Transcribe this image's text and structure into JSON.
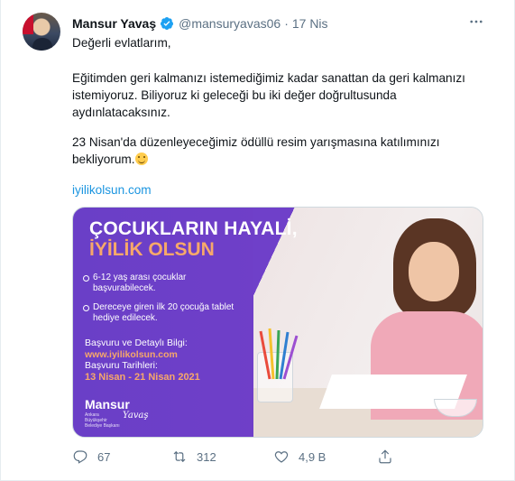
{
  "tweet": {
    "author_name": "Mansur Yavaş",
    "handle": "@mansuryavas06",
    "separator": "·",
    "date": "17 Nis",
    "verified": true,
    "more_icon": "ellipsis-icon",
    "paragraphs": [
      "Değerli evlatlarım,",
      "Eğitimden geri kalmanızı istemediğimiz kadar sanattan da geri kalmanızı istemiyoruz. Biliyoruz ki geleceği bu iki değer doğrultusunda aydınlatacaksınız.",
      "23 Nisan'da düzenleyeceğimiz ödüllü resim yarışmasına katılımınızı bekliyorum."
    ],
    "link": "iyilikolsun.com"
  },
  "card": {
    "title_line1": "ÇOCUKLARIN HAYALİ,",
    "title_line2": "İYİLİK OLSUN",
    "bullets": [
      "6-12 yaş arası çocuklar başvurabilecek.",
      "Dereceye giren ilk 20 çocuğa tablet hediye edilecek."
    ],
    "apply_label": "Başvuru ve Detaylı Bilgi:",
    "apply_url": "www.iyilikolsun.com",
    "dates_label": "Başvuru Tarihleri:",
    "dates_value": "13 Nisan - 21 Nisan 2021",
    "brand": "Mansur",
    "brand_script": "Yavaş",
    "brand_sub": "Ankara Büyükşehir Belediye Başkanı"
  },
  "actions": {
    "reply_count": "67",
    "retweet_count": "312",
    "like_count": "4,9 B",
    "share_label": ""
  },
  "colors": {
    "accent_blue": "#1b95e0",
    "muted_text": "#5b7083",
    "card_purple": "#6f40c9",
    "card_orange": "#f7a86a"
  }
}
